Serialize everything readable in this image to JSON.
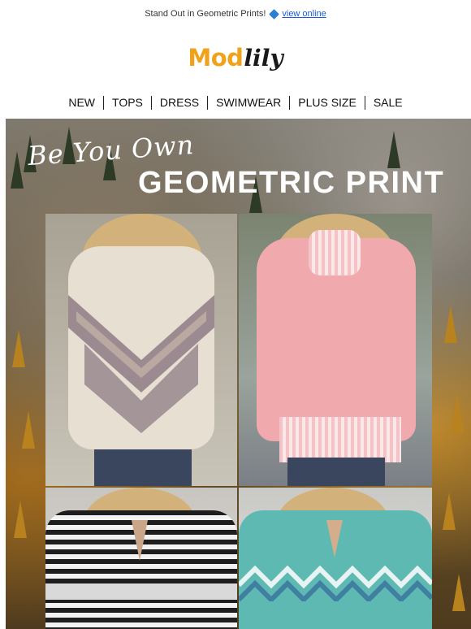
{
  "preheader": {
    "text": "Stand Out in Geometric Prints!",
    "link_label": "view online",
    "icon": "blue-diamond-icon"
  },
  "logo": {
    "part1": "Mod",
    "part2": "lily"
  },
  "nav": {
    "items": [
      {
        "label": "NEW"
      },
      {
        "label": "TOPS"
      },
      {
        "label": "DRESS"
      },
      {
        "label": "SWIMWEAR"
      },
      {
        "label": "PLUS SIZE"
      },
      {
        "label": "SALE"
      }
    ]
  },
  "hero": {
    "script_line": "Be You Own",
    "main_line": "GEOMETRIC PRINT"
  },
  "colors": {
    "logo_orange": "#f0a21a",
    "link_blue": "#1a5bd6",
    "diamond_blue": "#2a7fd4"
  }
}
